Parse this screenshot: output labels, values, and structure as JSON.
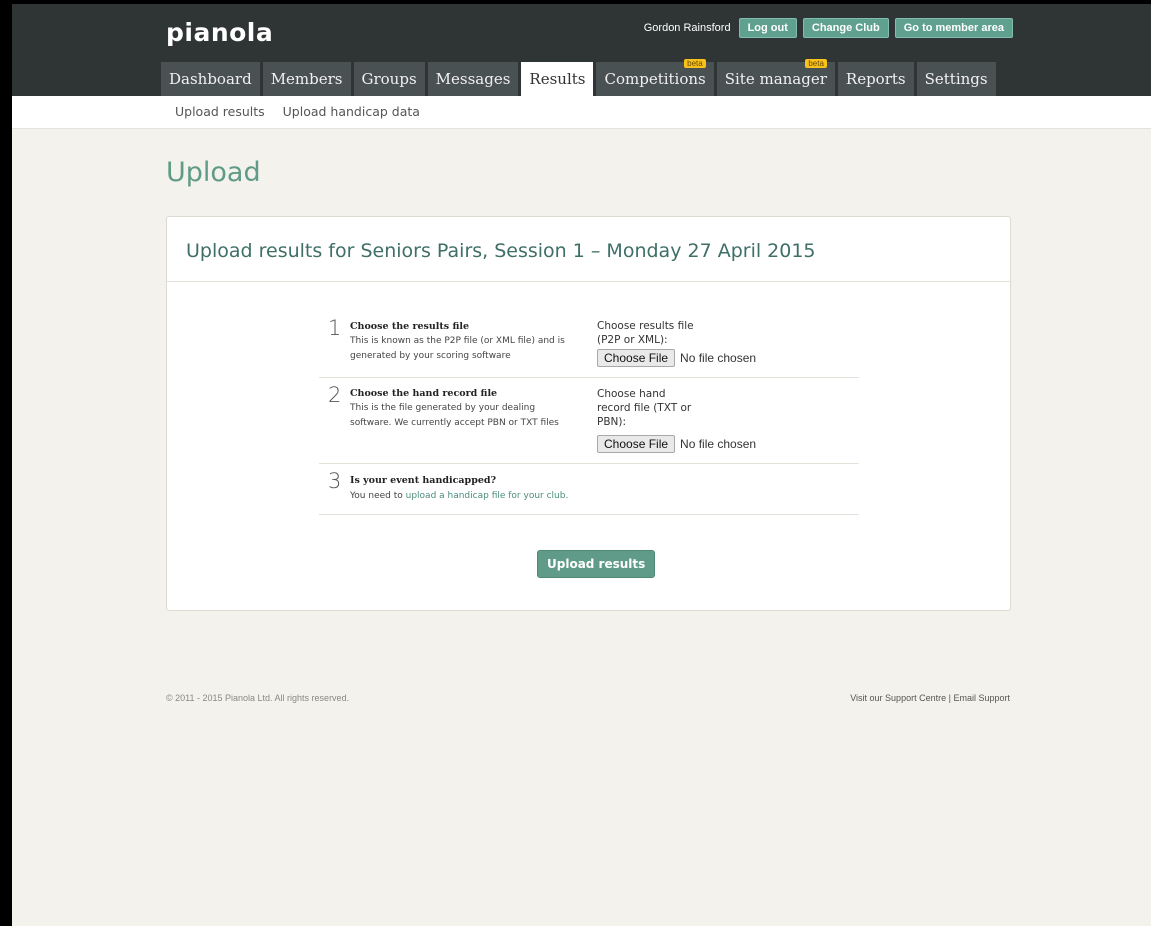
{
  "app": {
    "logo": "pianola"
  },
  "userbar": {
    "user_name": "Gordon Rainsford",
    "logout": "Log out",
    "change_club": "Change Club",
    "member_area": "Go to member area"
  },
  "nav": {
    "tabs": [
      {
        "label": "Dashboard"
      },
      {
        "label": "Members"
      },
      {
        "label": "Groups"
      },
      {
        "label": "Messages"
      },
      {
        "label": "Results",
        "active": true
      },
      {
        "label": "Competitions",
        "badge": "beta"
      },
      {
        "label": "Site manager",
        "badge": "beta"
      },
      {
        "label": "Reports"
      },
      {
        "label": "Settings"
      }
    ]
  },
  "subnav": {
    "items": [
      "Upload results",
      "Upload handicap data"
    ]
  },
  "page": {
    "title": "Upload"
  },
  "card": {
    "title": "Upload results for Seniors Pairs, Session 1 – Monday 27 April 2015",
    "steps": [
      {
        "num": "1",
        "title": "Choose the results file",
        "desc": "This is known as the P2P file (or XML file) and is generated by your scoring software",
        "field_label": "Choose results file (P2P or XML):",
        "button": "Choose File",
        "status": "No file chosen"
      },
      {
        "num": "2",
        "title": "Choose the hand record file",
        "desc": "This is the file generated by your dealing software. We currently accept PBN or TXT files",
        "field_label": "Choose hand record file (TXT or PBN):",
        "button": "Choose File",
        "status": "No file chosen"
      },
      {
        "num": "3",
        "title": "Is your event handicapped?",
        "desc_prefix": "You need to ",
        "desc_link": "upload a handicap file for your club."
      }
    ],
    "submit": "Upload results"
  },
  "footer": {
    "copyright": "© 2011 - 2015 Pianola Ltd. All rights reserved.",
    "support_link": "Visit our Support Centre",
    "separator": "|",
    "email_link": "Email Support"
  },
  "colors": {
    "topbar": "#2f3435",
    "accent": "#5f9b88",
    "beta_badge": "#f7c21c",
    "background": "#f4f2ec"
  }
}
